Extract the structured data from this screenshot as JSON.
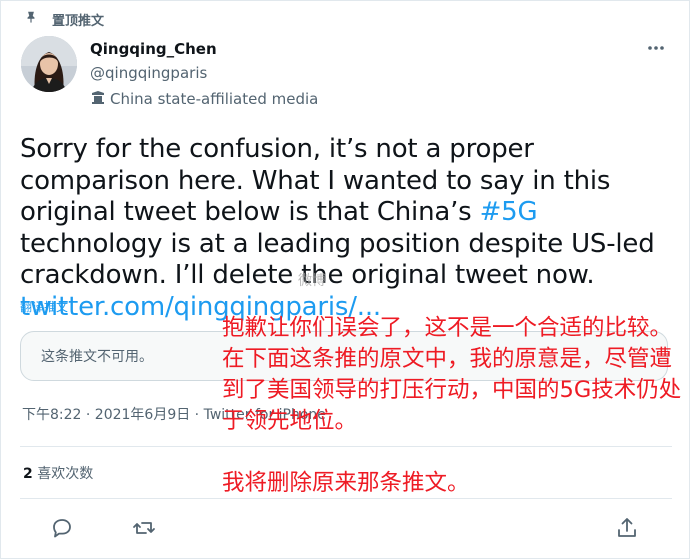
{
  "pinned_label": "置顶推文",
  "author": {
    "display_name": "Qingqing_Chen",
    "handle": "@qingqingparis",
    "affiliation": "China state-affiliated media"
  },
  "tweet": {
    "text_parts": [
      "Sorry for the confusion, it’s not a proper comparison here. What I wanted to say in this original tweet below is that China’s ",
      "#5G",
      " technology is at a leading position despite US-led crackdown. I’ll delete the original tweet now. ",
      "twitter.com/qingqingparis/..."
    ],
    "translate_label": "翻译推文",
    "quoted_unavailable": "这条推文不可用。",
    "meta": "下午8:22 · 2021年6月9日 · Twitter for iPhone",
    "stats_count": "2",
    "stats_label": "喜欢次数"
  },
  "overlay": {
    "text_1": "抱歉让你们误会了，这不是一个合适的比较。在下面这条推的原文中，我的原意是，尽管遭到了美国领导的打压行动，中国的5G技术仍处于领先地位。",
    "text_2": "我将删除原来那条推文。"
  },
  "watermark": "微博",
  "actions": [
    "reply-icon",
    "retweet-icon",
    "like-icon",
    "share-icon"
  ],
  "colors": {
    "link": "#1d9bf0",
    "overlay_text": "#ee1b24",
    "secondary_text": "#536471"
  }
}
